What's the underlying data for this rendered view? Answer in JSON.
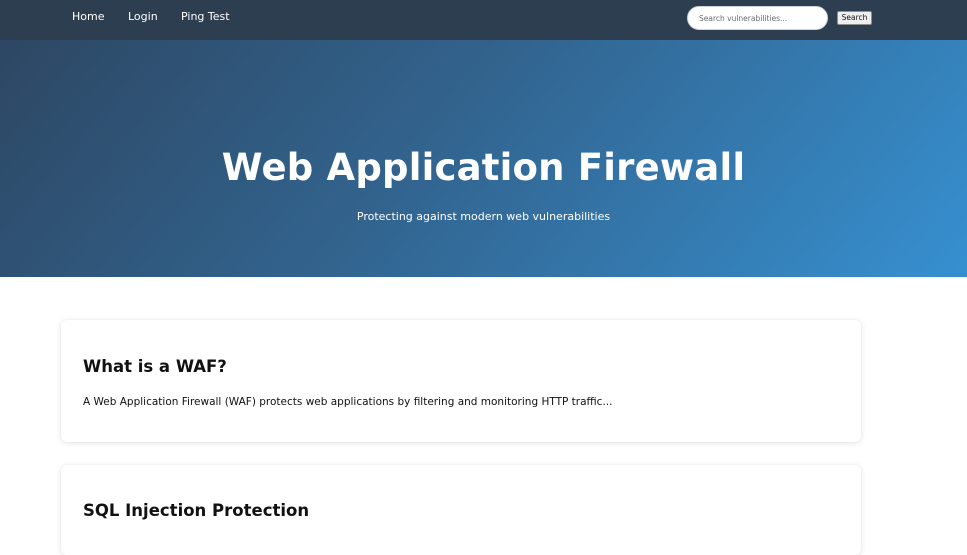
{
  "nav": {
    "links": [
      {
        "label": "Home"
      },
      {
        "label": "Login"
      },
      {
        "label": "Ping Test"
      }
    ],
    "search": {
      "placeholder": "Search vulnerabilities...",
      "value": "",
      "button_label": "Search"
    }
  },
  "hero": {
    "title": "Web Application Firewall",
    "subtitle": "Protecting against modern web vulnerabilities"
  },
  "sections": [
    {
      "title": "What is a WAF?",
      "text": "A Web Application Firewall (WAF) protects web applications by filtering and monitoring HTTP traffic..."
    },
    {
      "title": "SQL Injection Protection"
    }
  ],
  "colors": {
    "navbar": "#2c3e50",
    "hero_gradient_start": "#2d4763",
    "hero_gradient_end": "#3690d0",
    "text": "#111111"
  }
}
